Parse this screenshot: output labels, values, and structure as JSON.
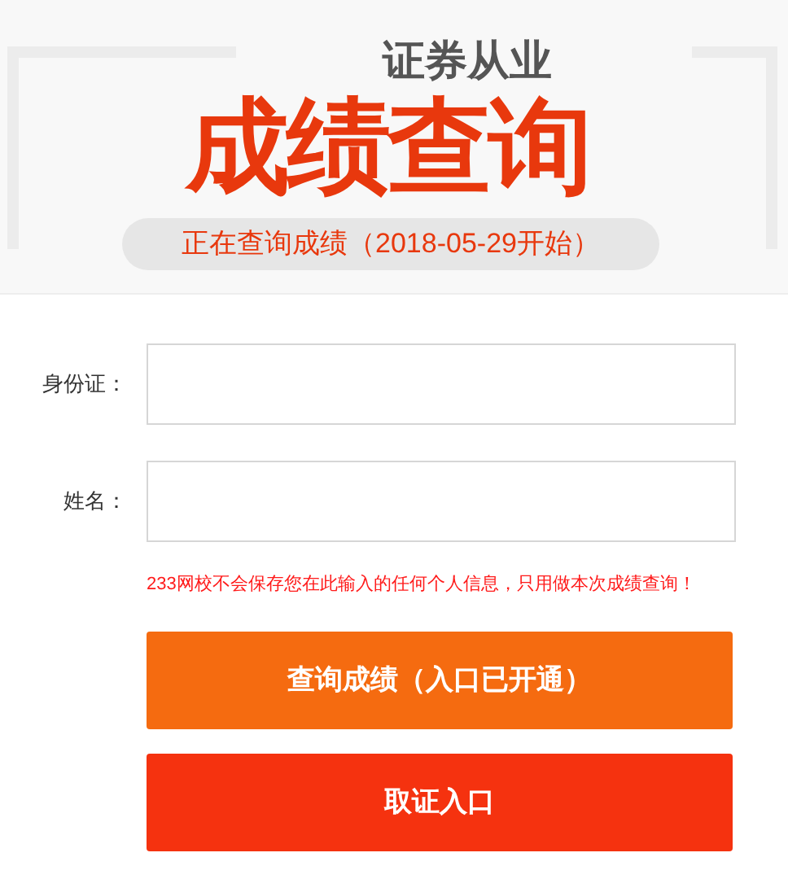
{
  "banner": {
    "subtitle": "证券从业",
    "title": "成绩查询",
    "status": "正在查询成绩（2018-05-29开始）"
  },
  "fields": [
    {
      "label": "身份证："
    },
    {
      "label": "姓名："
    }
  ],
  "notice": "233网校不会保存您在此输入的任何个人信息，只用做本次成绩查询！",
  "buttons": [
    {
      "label": "查询成绩（入口已开通）",
      "kind": "primary"
    },
    {
      "label": "取证入口",
      "kind": "secondary"
    }
  ]
}
